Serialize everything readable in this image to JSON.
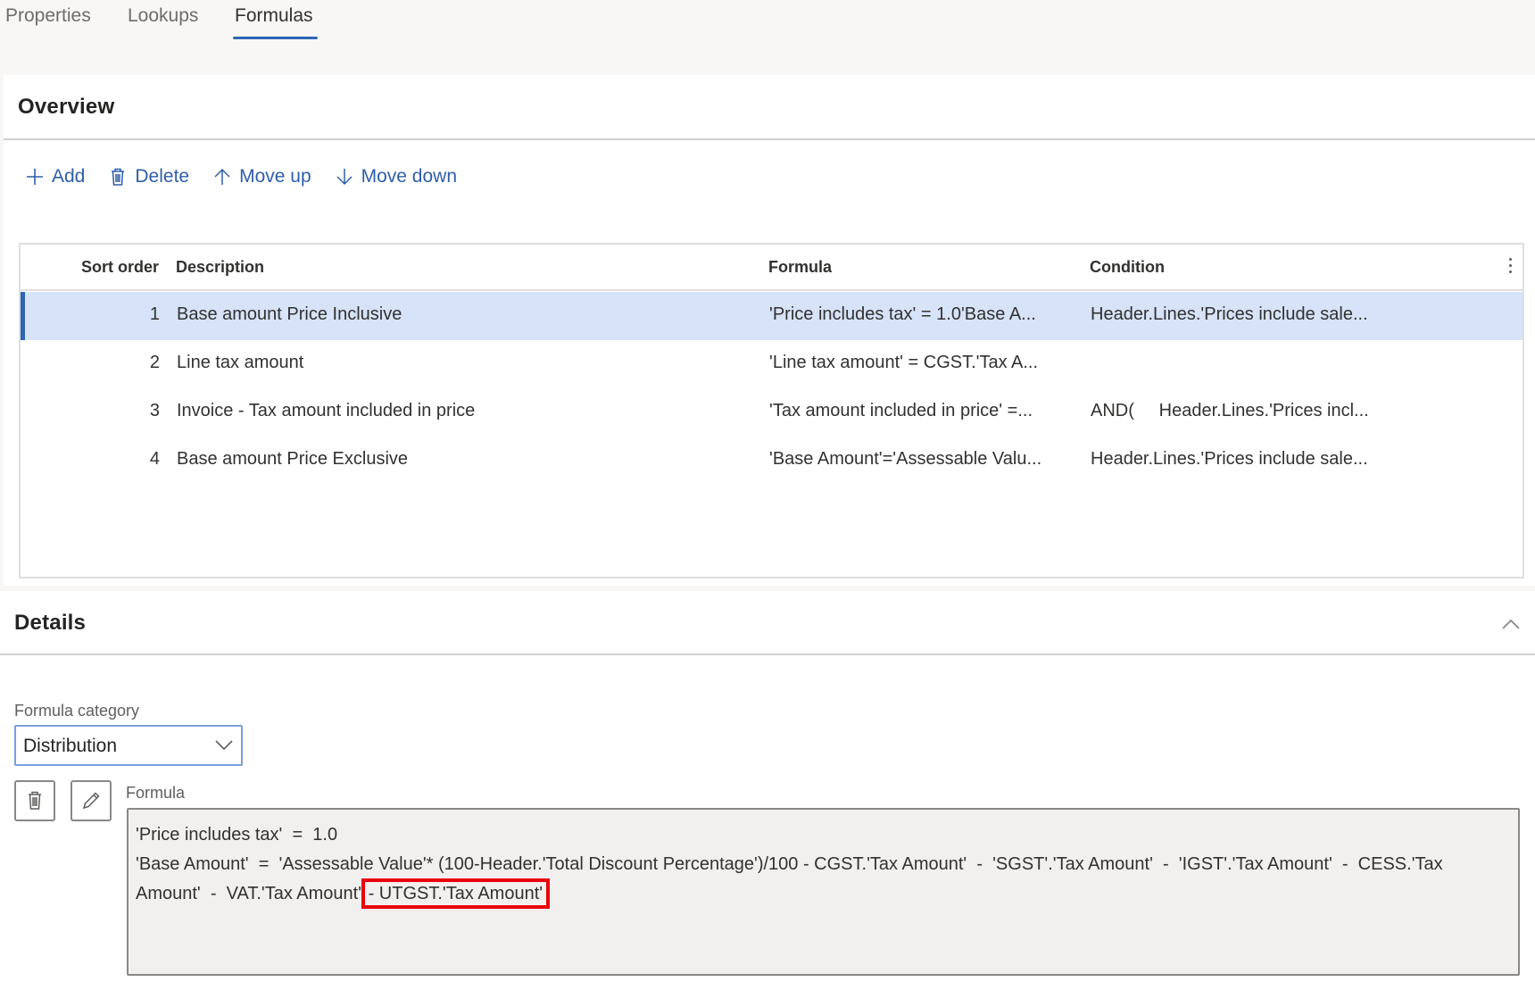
{
  "tabs": [
    {
      "label": "Properties",
      "active": false
    },
    {
      "label": "Lookups",
      "active": false
    },
    {
      "label": "Formulas",
      "active": true
    }
  ],
  "overview": {
    "title": "Overview",
    "toolbar": {
      "add_label": "Add",
      "delete_label": "Delete",
      "move_up_label": "Move up",
      "move_down_label": "Move down"
    },
    "grid": {
      "columns": [
        "Sort order",
        "Description",
        "Formula",
        "Condition"
      ],
      "rows": [
        {
          "sort_order": "1",
          "description": "Base amount Price Inclusive",
          "formula": "'Price includes tax'  =  1.0'Base A...",
          "condition": "Header.Lines.'Prices include sale...",
          "selected": true
        },
        {
          "sort_order": "2",
          "description": "Line tax amount",
          "formula": "'Line tax amount'  =  CGST.'Tax A...",
          "condition": "",
          "selected": false
        },
        {
          "sort_order": "3",
          "description": "Invoice - Tax amount included in price",
          "formula": "'Tax amount included in price'  =...",
          "condition": "AND(     Header.Lines.'Prices incl...",
          "selected": false
        },
        {
          "sort_order": "4",
          "description": "Base amount Price Exclusive",
          "formula": "'Base Amount'='Assessable Valu...",
          "condition": "Header.Lines.'Prices include sale...",
          "selected": false
        }
      ]
    }
  },
  "details": {
    "title": "Details",
    "formula_category_label": "Formula category",
    "formula_category_value": "Distribution",
    "formula_label": "Formula",
    "formula_lines": [
      "'Price includes tax'  =  1.0",
      "'Base Amount'  =  'Assessable Value'* (100-Header.'Total Discount Percentage')/100 - CGST.'Tax Amount'  -  'SGST'.'Tax Amount'  -  'IGST'.'Tax Amount'  -  CESS.'Tax",
      "Amount'  -  VAT.'Tax Amount' "
    ],
    "formula_highlight": "- UTGST.'Tax Amount'"
  },
  "colors": {
    "accent": "#2e66b4",
    "selected_row": "#d6e3f8",
    "highlight_box": "#e8000b"
  }
}
